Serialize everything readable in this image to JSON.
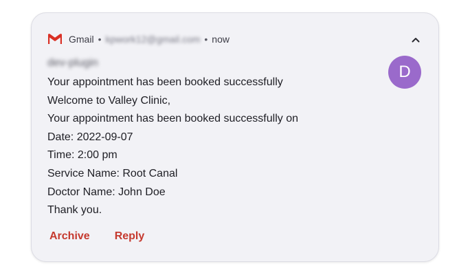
{
  "notification": {
    "app_name": "Gmail",
    "separator": "•",
    "account_email": "kpwork12@gmail.com",
    "time": "now",
    "avatar_letter": "D",
    "avatar_color": "#9a6acb",
    "sender": "dev-plugin",
    "subject": "Your appointment has been booked successfully",
    "lines": [
      "Welcome to Valley Clinic,",
      "Your appointment has been booked successfully on",
      "Date: 2022-09-07",
      "Time: 2:00 pm",
      "Service Name: Root Canal",
      "Doctor Name: John Doe",
      "Thank you."
    ]
  },
  "actions": {
    "archive_label": "Archive",
    "reply_label": "Reply"
  },
  "icons": {
    "app": "gmail-icon",
    "collapse": "chevron-up-icon"
  },
  "colors": {
    "accent": "#c5392e",
    "card_bg": "#f2f2f6"
  }
}
